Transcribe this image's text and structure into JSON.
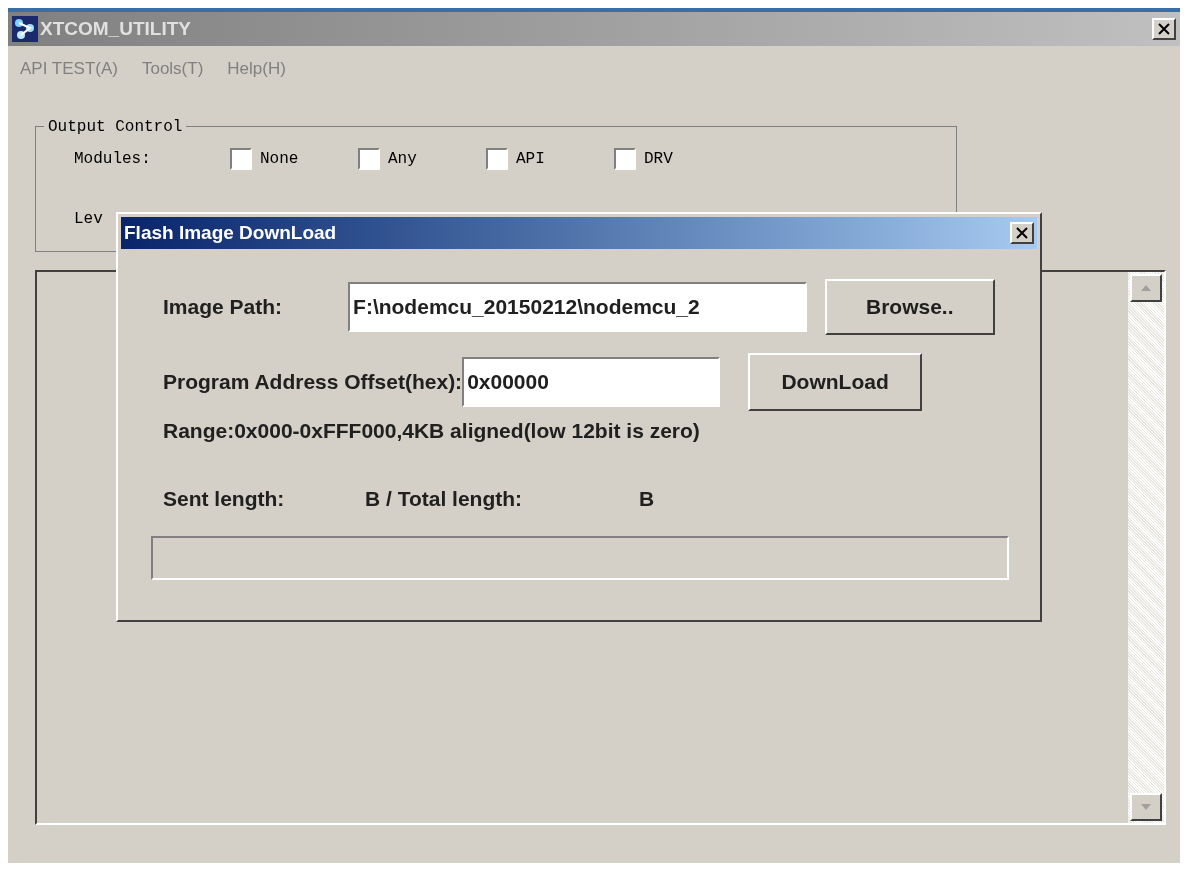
{
  "window": {
    "title": "XTCOM_UTILITY"
  },
  "menu": [
    "API TEST(A)",
    "Tools(T)",
    "Help(H)"
  ],
  "output_control": {
    "title": "Output Control",
    "modules_label": "Modules:",
    "modules": [
      {
        "label": "None",
        "checked": false
      },
      {
        "label": "Any",
        "checked": false
      },
      {
        "label": "API",
        "checked": false
      },
      {
        "label": "DRV",
        "checked": false
      }
    ],
    "level_label": "Lev"
  },
  "dialog": {
    "title": "Flash Image DownLoad",
    "image_path_label": "Image Path:",
    "image_path": "F:\\nodemcu_20150212\\nodemcu_2",
    "browse_button": "Browse..",
    "offset_label": "Program Address Offset(hex):",
    "offset": "0x00000",
    "download_button": "DownLoad",
    "range_note": "Range:0x000-0xFFF000,4KB aligned(low 12bit is zero)",
    "sent_label": "Sent length:",
    "total_label": "B / Total length:",
    "total_unit": "B"
  }
}
